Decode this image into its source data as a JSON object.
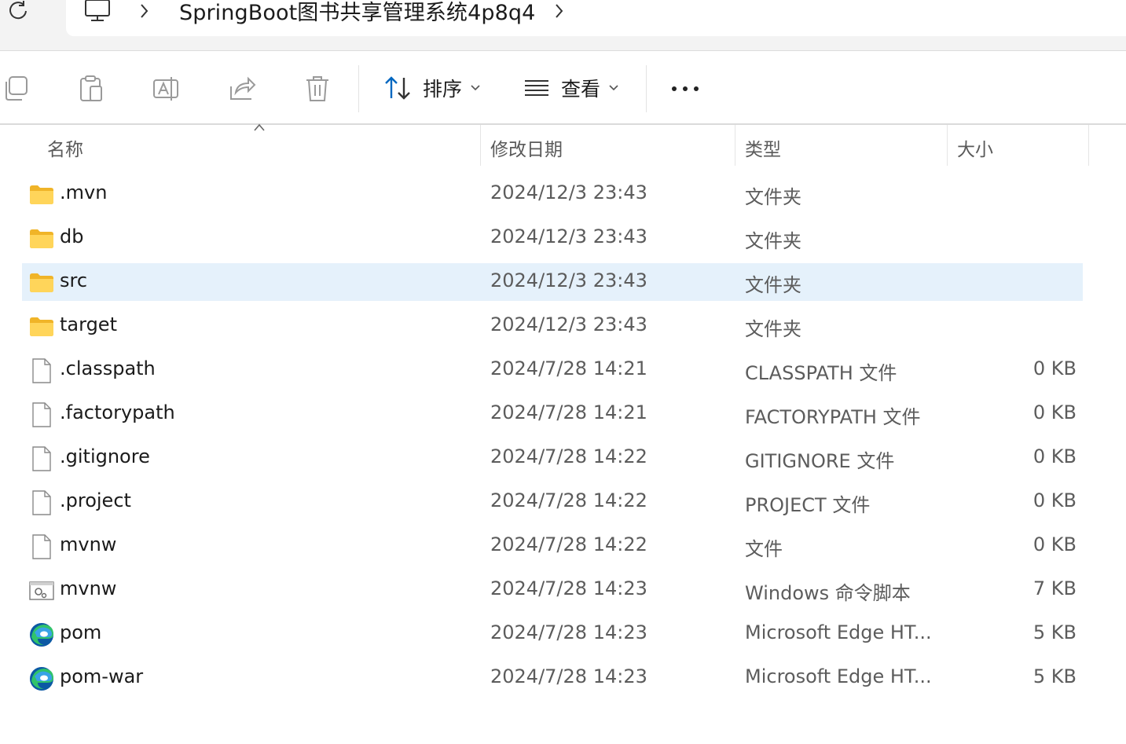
{
  "address": {
    "crumbs": [
      "SpringBoot图书共享管理系统4p8q4"
    ]
  },
  "toolbar": {
    "sort_label": "排序",
    "view_label": "查看"
  },
  "columns": {
    "name": "名称",
    "date": "修改日期",
    "type": "类型",
    "size": "大小"
  },
  "rows": [
    {
      "icon": "folder-icon",
      "name": ".mvn",
      "date": "2024/12/3 23:43",
      "type": "文件夹",
      "size": ""
    },
    {
      "icon": "folder-icon",
      "name": "db",
      "date": "2024/12/3 23:43",
      "type": "文件夹",
      "size": ""
    },
    {
      "icon": "folder-icon",
      "name": "src",
      "date": "2024/12/3 23:43",
      "type": "文件夹",
      "size": "",
      "selected": true
    },
    {
      "icon": "folder-icon",
      "name": "target",
      "date": "2024/12/3 23:43",
      "type": "文件夹",
      "size": ""
    },
    {
      "icon": "file-icon",
      "name": ".classpath",
      "date": "2024/7/28 14:21",
      "type": "CLASSPATH 文件",
      "size": "0 KB"
    },
    {
      "icon": "file-icon",
      "name": ".factorypath",
      "date": "2024/7/28 14:21",
      "type": "FACTORYPATH 文件",
      "size": "0 KB"
    },
    {
      "icon": "file-icon",
      "name": ".gitignore",
      "date": "2024/7/28 14:22",
      "type": "GITIGNORE 文件",
      "size": "0 KB"
    },
    {
      "icon": "file-icon",
      "name": ".project",
      "date": "2024/7/28 14:22",
      "type": "PROJECT 文件",
      "size": "0 KB"
    },
    {
      "icon": "file-icon",
      "name": "mvnw",
      "date": "2024/7/28 14:22",
      "type": "文件",
      "size": "0 KB"
    },
    {
      "icon": "script-icon",
      "name": "mvnw",
      "date": "2024/7/28 14:23",
      "type": "Windows 命令脚本",
      "size": "7 KB"
    },
    {
      "icon": "edge-icon",
      "name": "pom",
      "date": "2024/7/28 14:23",
      "type": "Microsoft Edge HT...",
      "size": "5 KB"
    },
    {
      "icon": "edge-icon",
      "name": "pom-war",
      "date": "2024/7/28 14:23",
      "type": "Microsoft Edge HT...",
      "size": "5 KB"
    }
  ],
  "colors": {
    "selection": "#e5f1fb",
    "folder": "#f8c93a",
    "accent": "#0067c0"
  }
}
